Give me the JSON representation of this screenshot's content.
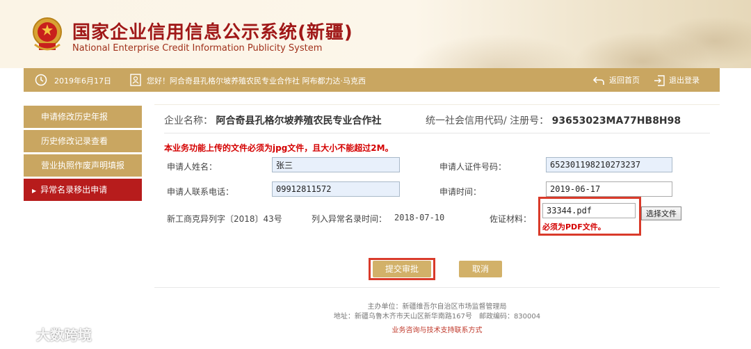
{
  "header": {
    "title": "国家企业信用信息公示系统(新疆)",
    "subtitle": "National Enterprise Credit Information Publicity System"
  },
  "topbar": {
    "date": "2019年6月17日",
    "greeting": "您好！阿合奇县孔格尔坡养殖农民专业合作社 阿布都力达·马克西",
    "home_label": "返回首页",
    "logout_label": "退出登录"
  },
  "sidebar": {
    "items": [
      {
        "label": "申请修改历史年报",
        "active": false
      },
      {
        "label": "历史修改记录查看",
        "active": false
      },
      {
        "label": "营业执照作废声明填报",
        "active": false
      },
      {
        "label": "异常名录移出申请",
        "active": true
      }
    ]
  },
  "company": {
    "name_label": "企业名称：",
    "name": "阿合奇县孔格尔坡养殖农民专业合作社",
    "credit_label": "统一社会信用代码/ 注册号：",
    "credit_code": "93653023MA77HB8H98"
  },
  "form": {
    "warning": "本业务功能上传的文件必须为jpg文件，且大小不能超过2M。",
    "applicant_name_label": "申请人姓名：",
    "applicant_name": "张三",
    "id_label": "申请人证件号码：",
    "id_number": "652301198210273237",
    "phone_label": "申请人联系电话：",
    "phone": "09912811572",
    "apply_time_label": "申请时间：",
    "apply_time": "2019-06-17",
    "doc_number": "新工商克异列字〔2018〕43号",
    "listed_time_label": "列入异常名录时间：",
    "listed_time": "2018-07-10",
    "evidence_label": "佐证材料：",
    "evidence_file": "33344.pdf",
    "choose_file_label": "选择文件",
    "pdf_note": "必须为PDF文件。",
    "submit_label": "提交审批",
    "cancel_label": "取消"
  },
  "footer": {
    "organizer": "主办单位：新疆维吾尔自治区市场监督管理局",
    "address": "地址：新疆乌鲁木齐市天山区新华南路167号　邮政编码：830004",
    "support_link": "业务咨询与技术支持联系方式"
  },
  "watermark": "大数跨境",
  "colors": {
    "gold": "#c9a661",
    "active_red": "#b71c1c",
    "warning_red": "#d40000",
    "title_red": "#a01818"
  }
}
